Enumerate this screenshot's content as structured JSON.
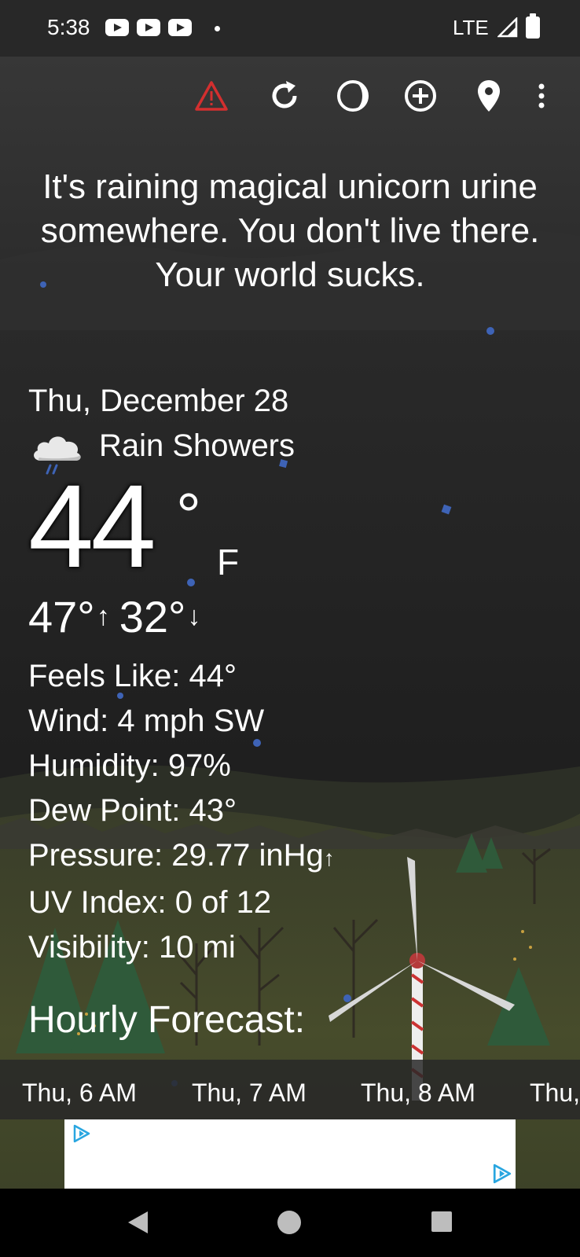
{
  "status_bar": {
    "time": "5:38",
    "network": "LTE",
    "app_icons": [
      "youtube-icon",
      "youtube-icon",
      "youtube-icon"
    ]
  },
  "toolbar": {
    "icons": [
      "alert-icon",
      "refresh-icon",
      "moon-phase-icon",
      "add-location-icon",
      "location-pin-icon",
      "more-vert-icon"
    ],
    "alert_color": "#d32f2f"
  },
  "message": "It's raining magical unicorn urine somewhere. You don't live there. Your world sucks.",
  "weather": {
    "date": "Thu, December 28",
    "condition": "Rain Showers",
    "temperature": "44",
    "degree_symbol": "°",
    "unit": "F",
    "high": "47°",
    "low": "32°",
    "high_arrow": "↑",
    "low_arrow": "↓"
  },
  "details": {
    "feels_like": "Feels Like:  44°",
    "wind": "Wind:  4 mph SW",
    "humidity": "Humidity:  97%",
    "dew_point": "Dew Point:  43°",
    "pressure": "Pressure:  29.77 inHg",
    "pressure_trend": "↑",
    "uv_index": "UV Index:  0 of 12",
    "visibility": "Visibility:  10 mi"
  },
  "hourly": {
    "title": "Hourly Forecast:",
    "hours": [
      "Thu, 6 AM",
      "Thu, 7 AM",
      "Thu, 8 AM",
      "Thu,"
    ]
  },
  "ad": {
    "icon": "ad-choices-icon"
  },
  "nav": {
    "icons": [
      "back-icon",
      "home-icon",
      "recents-icon"
    ]
  }
}
